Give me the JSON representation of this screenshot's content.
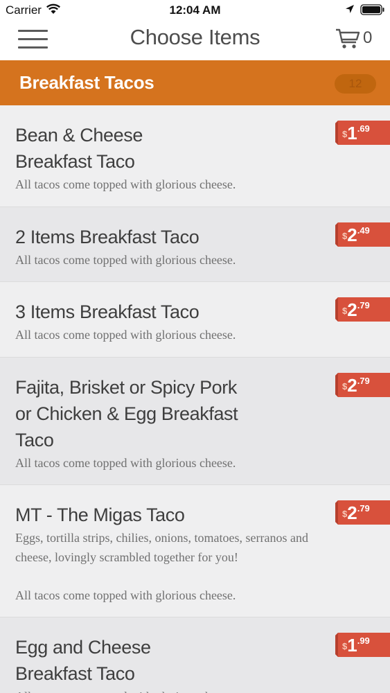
{
  "status_bar": {
    "carrier": "Carrier",
    "time": "12:04 AM"
  },
  "nav": {
    "title": "Choose Items",
    "cart_count": "0"
  },
  "category": {
    "title": "Breakfast Tacos",
    "count": "12"
  },
  "colors": {
    "accent": "#d5731e",
    "price_tag": "#d8513c"
  },
  "items": [
    {
      "name_lines": [
        "Bean & Cheese",
        "Breakfast Taco"
      ],
      "description": "All tacos come topped with glorious cheese.",
      "price_dollar": "$",
      "price_whole": "1",
      "price_cents": ".69"
    },
    {
      "name_lines": [
        "2 Items Breakfast Taco"
      ],
      "description": "All tacos come topped with glorious cheese.",
      "price_dollar": "$",
      "price_whole": "2",
      "price_cents": ".49"
    },
    {
      "name_lines": [
        "3 Items Breakfast Taco"
      ],
      "description": "All tacos come topped with glorious cheese.",
      "price_dollar": "$",
      "price_whole": "2",
      "price_cents": ".79"
    },
    {
      "name_lines": [
        "Fajita, Brisket or Spicy Pork",
        "or Chicken & Egg Breakfast",
        "Taco"
      ],
      "description": "All tacos come topped with glorious cheese.",
      "price_dollar": "$",
      "price_whole": "2",
      "price_cents": ".79"
    },
    {
      "name_lines": [
        "MT - The Migas Taco"
      ],
      "extra_description_lines": [
        "Eggs, tortilla strips, chilies, onions, tomatoes, serranos and",
        "cheese, lovingly scrambled together for you!"
      ],
      "description": "All tacos come topped with glorious cheese.",
      "price_dollar": "$",
      "price_whole": "2",
      "price_cents": ".79"
    },
    {
      "name_lines": [
        "Egg and Cheese",
        "Breakfast Taco"
      ],
      "description": "All tacos come topped with glorious cheese.",
      "price_dollar": "$",
      "price_whole": "1",
      "price_cents": ".99"
    }
  ]
}
